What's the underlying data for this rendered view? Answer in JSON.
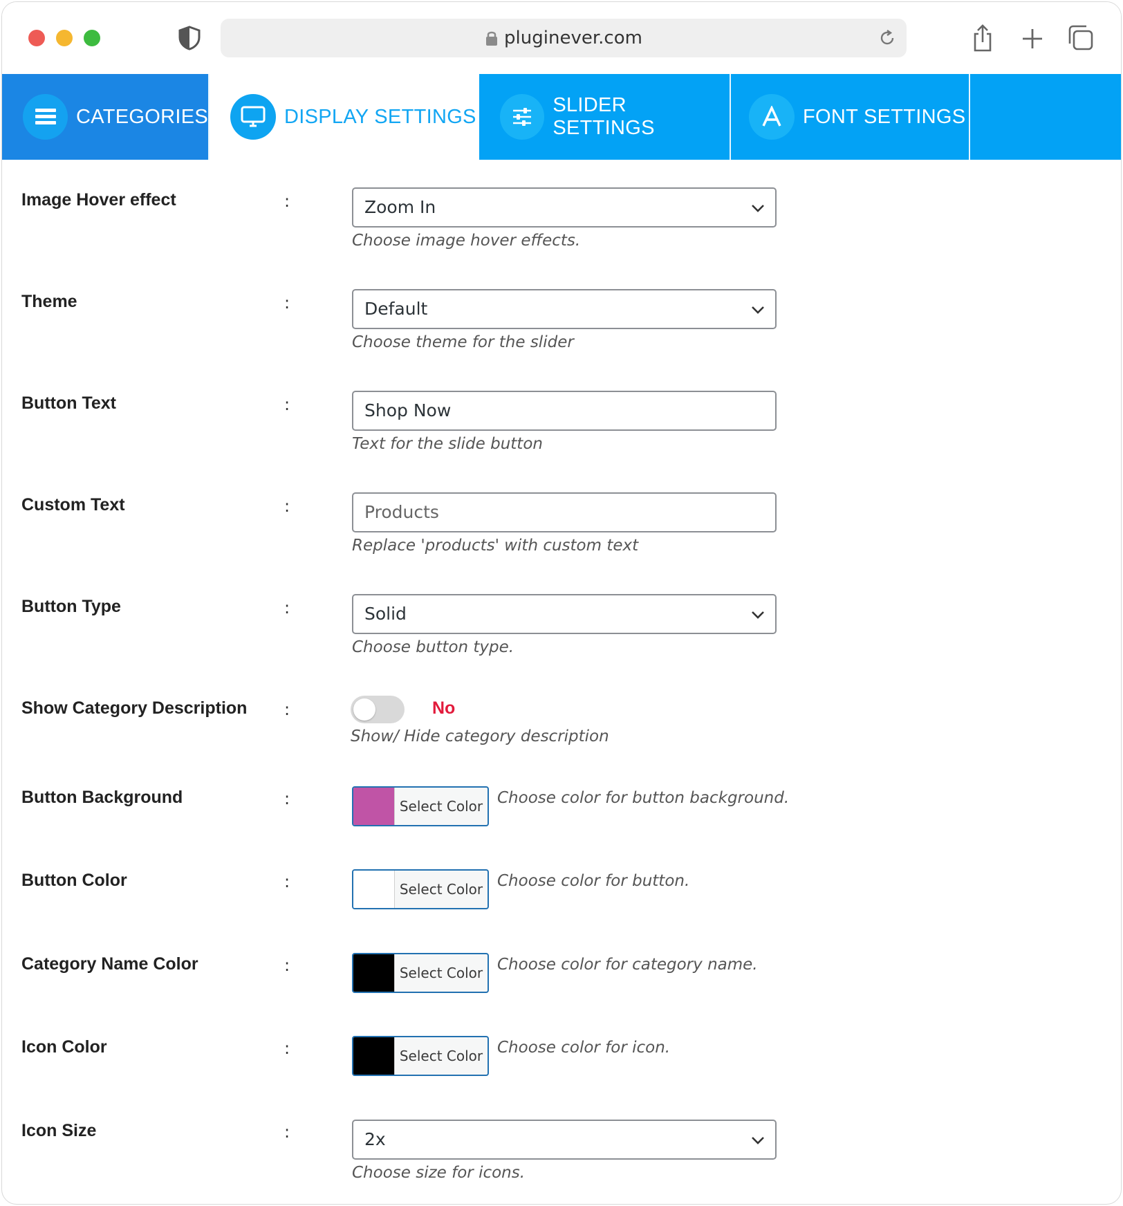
{
  "browser": {
    "url": "pluginever.com"
  },
  "tabs": [
    {
      "label": "CATEGORIES",
      "icon": "list-icon"
    },
    {
      "label": "DISPLAY SETTINGS",
      "icon": "monitor-icon",
      "active": true
    },
    {
      "label": "SLIDER SETTINGS",
      "icon": "sliders-icon"
    },
    {
      "label": "FONT SETTINGS",
      "icon": "font-icon"
    }
  ],
  "colors": {
    "tab_bar": "#03a2f5",
    "active_tab_text": "#12a6f3",
    "toggle_no": "#e21b3c",
    "picker_border": "#2271b1"
  },
  "form": {
    "hover_effect": {
      "label": "Image Hover effect",
      "value": "Zoom In",
      "help": "Choose image hover effects."
    },
    "theme": {
      "label": "Theme",
      "value": "Default",
      "help": "Choose theme for the slider"
    },
    "button_text": {
      "label": "Button Text",
      "value": "Shop Now",
      "help": "Text for the slide button"
    },
    "custom_text": {
      "label": "Custom Text",
      "placeholder": "Products",
      "help": "Replace 'products' with custom text"
    },
    "button_type": {
      "label": "Button Type",
      "value": "Solid",
      "help": "Choose button type."
    },
    "show_description": {
      "label": "Show Category Description",
      "state": "No",
      "help": "Show/ Hide category description"
    },
    "button_background": {
      "label": "Button Background",
      "button": "Select Color",
      "color": "#c054a6",
      "help": "Choose color for button background."
    },
    "button_color": {
      "label": "Button Color",
      "button": "Select Color",
      "color": "#ffffff",
      "help": "Choose color for button."
    },
    "category_name_color": {
      "label": "Category Name Color",
      "button": "Select Color",
      "color": "#000000",
      "help": "Choose color for category name."
    },
    "icon_color": {
      "label": "Icon Color",
      "button": "Select Color",
      "color": "#000000",
      "help": "Choose color for icon."
    },
    "icon_size": {
      "label": "Icon Size",
      "value": "2x",
      "help": "Choose size for icons."
    }
  },
  "separator": ":"
}
